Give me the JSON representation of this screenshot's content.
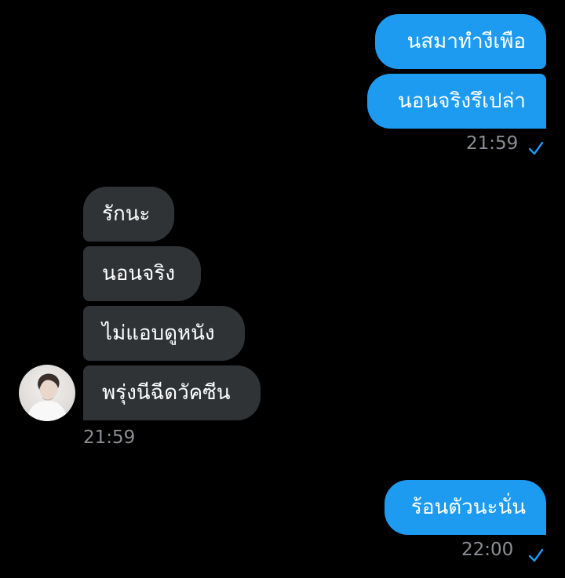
{
  "colors": {
    "background": "#000000",
    "outgoing_bubble": "#1d9bf0",
    "incoming_bubble": "#2f3336",
    "timestamp": "#8b8f94",
    "read_check": "#1d9bf0"
  },
  "conversation": {
    "outgoing_group_1": {
      "messages": [
        "นสมาทำงีเพือ",
        "นอนจริงรึเปล่า"
      ],
      "time": "21:59",
      "status_icon": "read-check-icon"
    },
    "incoming_group_1": {
      "messages": [
        "รักนะ",
        "นอนจริง",
        "ไม่แอบดูหนัง",
        "พรุ่งนีฉีดวัคซีน"
      ],
      "time": "21:59",
      "sender_avatar_icon": "contact-avatar"
    },
    "outgoing_group_2": {
      "messages": [
        "ร้อนตัวนะนั่น"
      ],
      "time": "22:00",
      "status_icon": "read-check-icon"
    }
  }
}
